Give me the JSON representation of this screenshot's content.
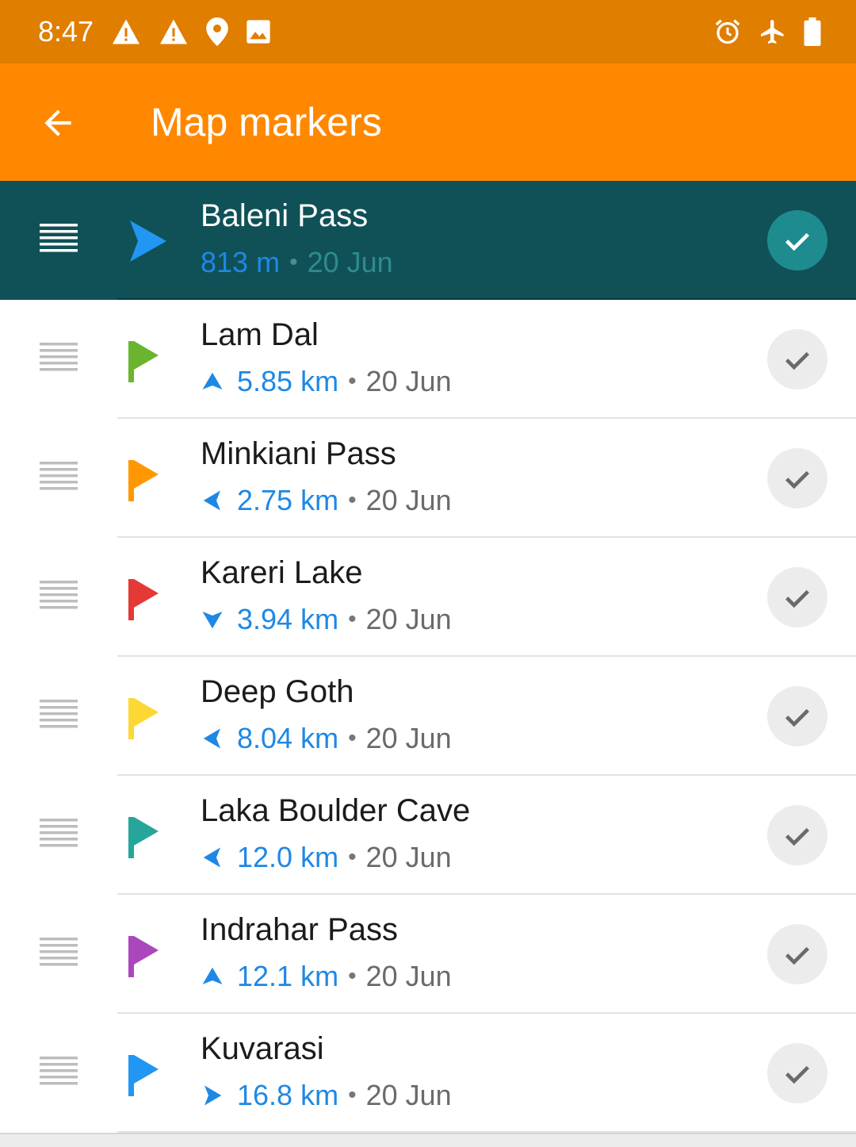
{
  "status_bar": {
    "time": "8:47",
    "icons_left": [
      "warning-icon",
      "warning-icon",
      "location-pin-icon",
      "image-icon"
    ],
    "icons_right": [
      "alarm-icon",
      "airplane-icon",
      "battery-icon"
    ],
    "color": "#e07e00"
  },
  "app_bar": {
    "title": "Map markers",
    "back_icon": "arrow-left-icon",
    "color": "#ff8800"
  },
  "markers": [
    {
      "name": "Baleni Pass",
      "distance": "813 m",
      "date": "20 Jun",
      "flag_color": "#2196f3",
      "direction": "active-nav",
      "active": true
    },
    {
      "name": "Lam Dal",
      "distance": "5.85 km",
      "date": "20 Jun",
      "flag_color": "#6ab42f",
      "direction": "up"
    },
    {
      "name": "Minkiani Pass",
      "distance": "2.75 km",
      "date": "20 Jun",
      "flag_color": "#ff9800",
      "direction": "left"
    },
    {
      "name": "Kareri Lake",
      "distance": "3.94 km",
      "date": "20 Jun",
      "flag_color": "#e53935",
      "direction": "down"
    },
    {
      "name": "Deep Goth",
      "distance": "8.04 km",
      "date": "20 Jun",
      "flag_color": "#fdd835",
      "direction": "left"
    },
    {
      "name": "Laka Boulder Cave",
      "distance": "12.0 km",
      "date": "20 Jun",
      "flag_color": "#26a69a",
      "direction": "left"
    },
    {
      "name": "Indrahar Pass",
      "distance": "12.1 km",
      "date": "20 Jun",
      "flag_color": "#ab47bc",
      "direction": "up"
    },
    {
      "name": "Kuvarasi",
      "distance": "16.8 km",
      "date": "20 Jun",
      "flag_color": "#2196f3",
      "direction": "right"
    }
  ],
  "separator": "•",
  "accent_distance_color": "#1e88e5",
  "active_row_color": "#0f5157"
}
